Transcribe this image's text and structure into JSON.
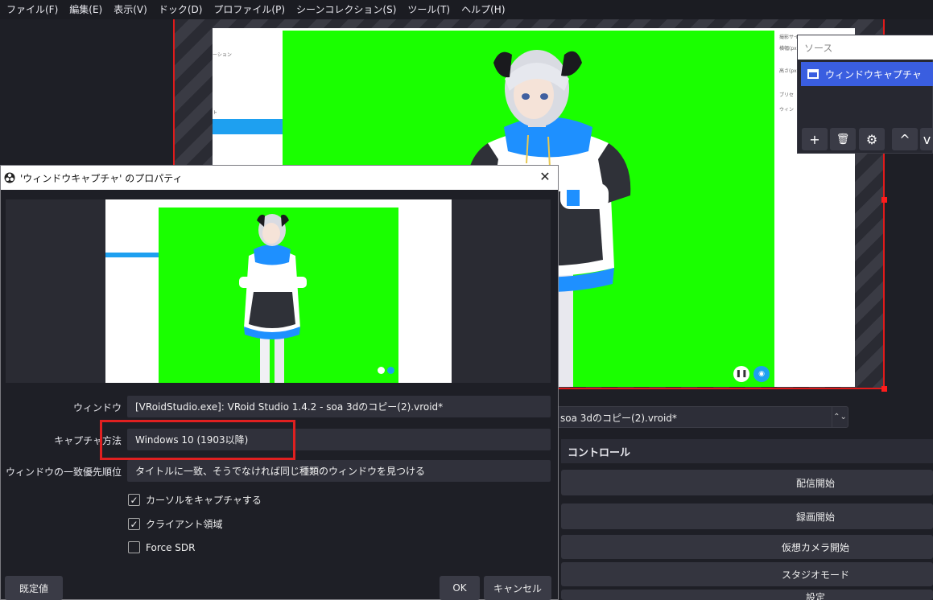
{
  "menubar": {
    "items": [
      "ファイル(F)",
      "編集(E)",
      "表示(V)",
      "ドック(D)",
      "プロファイル(P)",
      "シーンコレクション(S)",
      "ツール(T)",
      "ヘルプ(H)"
    ]
  },
  "sources": {
    "title_placeholder": "ソース",
    "item_label": "ウィンドウキャプチャ",
    "add": "+",
    "remove": "🗑",
    "settings": "⚙",
    "up": "^",
    "down": "v"
  },
  "window_select": {
    "value": "soa 3dのコピー(2).vroid*",
    "spin": "⌃⌄"
  },
  "controls": {
    "header": "コントロール",
    "buttons": [
      "配信開始",
      "録画開始",
      "仮想カメラ開始",
      "スタジオモード",
      "設定"
    ]
  },
  "dialog": {
    "title": "'ウィンドウキャプチャ' のプロパティ",
    "close": "✕",
    "fields": {
      "window_label": "ウィンドウ",
      "window_value": "[VRoidStudio.exe]: VRoid Studio 1.4.2 - soa 3dのコピー(2).vroid*",
      "method_label": "キャプチャ方法",
      "method_value": "Windows 10 (1903以降)",
      "priority_label": "ウィンドウの一致優先順位",
      "priority_value": "タイトルに一致、そうでなければ同じ種類のウィンドウを見つける"
    },
    "checks": [
      {
        "label": "カーソルをキャプチャする",
        "checked": true,
        "mark": "✓"
      },
      {
        "label": "クライアント領域",
        "checked": true,
        "mark": "✓"
      },
      {
        "label": "Force SDR",
        "checked": false,
        "mark": ""
      }
    ],
    "defaults_button": "既定値",
    "ok_button": "OK",
    "cancel_button": "キャンセル"
  },
  "vroid": {
    "left_texts": [
      "ーション",
      "ト"
    ],
    "right_texts": [
      "撮影サイ",
      "横幅(px",
      "高さ(px",
      "プリセ",
      "ウィン"
    ]
  },
  "colors": {
    "green_screen": "#1aff00",
    "selection_blue": "#3a5ee0",
    "highlight_red": "#e02020"
  }
}
